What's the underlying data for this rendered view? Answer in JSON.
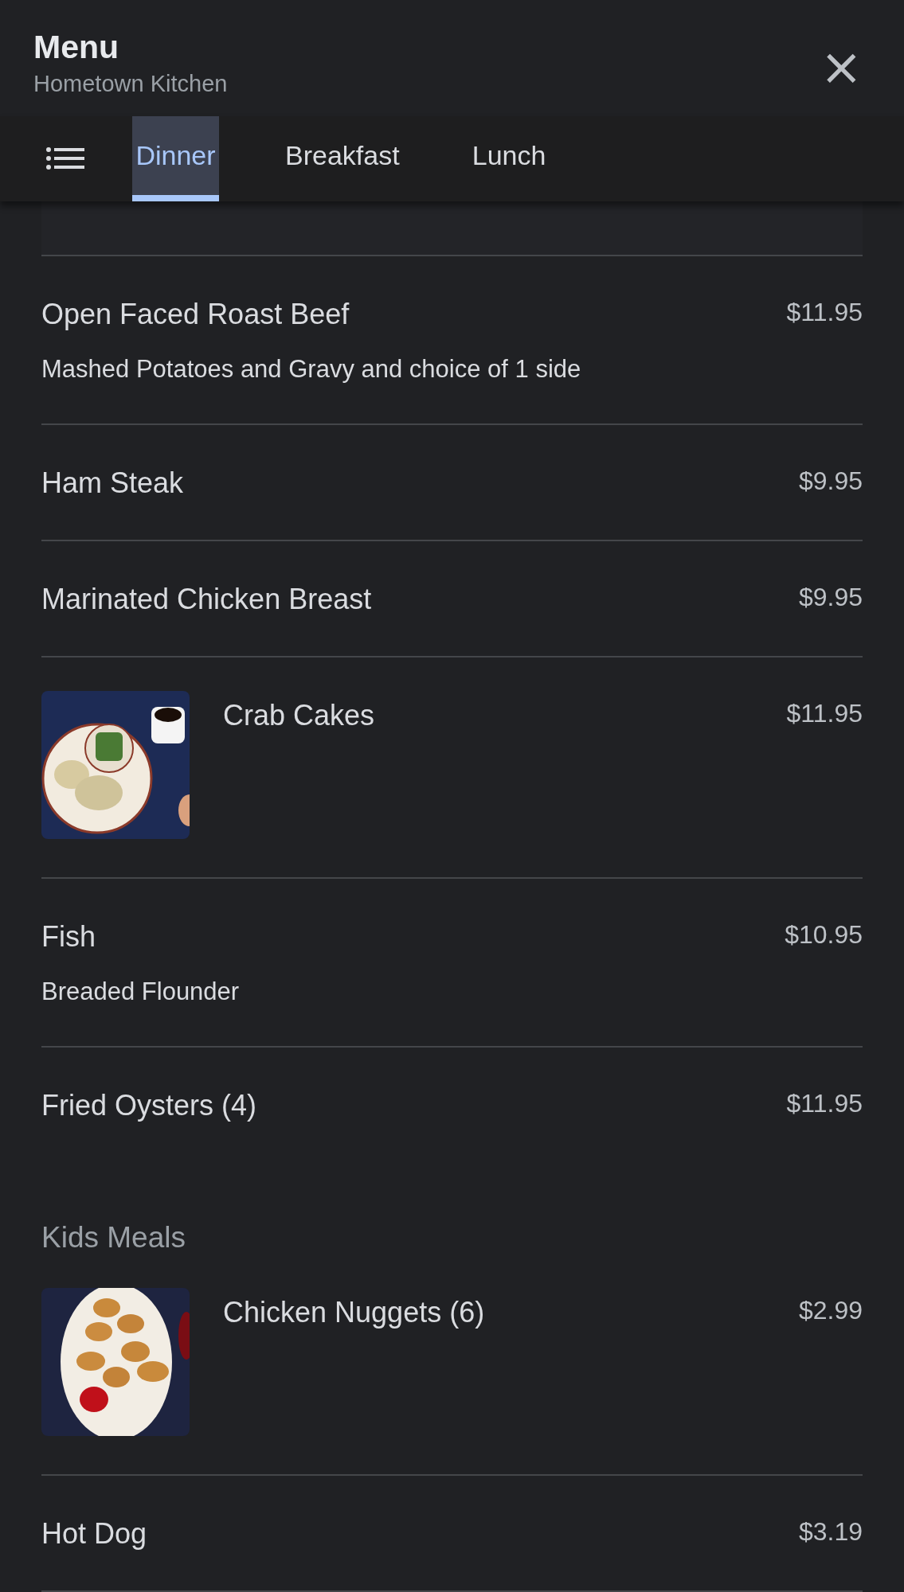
{
  "header": {
    "title": "Menu",
    "subtitle": "Hometown Kitchen",
    "close": "×"
  },
  "tabs": [
    {
      "label": "Dinner",
      "selected": true
    },
    {
      "label": "Breakfast",
      "selected": false
    },
    {
      "label": "Lunch",
      "selected": false
    }
  ],
  "sections": [
    {
      "items": [
        {
          "name": "Open Faced Roast Beef",
          "price": "$11.95",
          "description": "Mashed Potatoes and Gravy and choice of 1 side"
        },
        {
          "name": "Ham Steak",
          "price": "$9.95"
        },
        {
          "name": "Marinated Chicken Breast",
          "price": "$9.95"
        },
        {
          "name": "Crab Cakes",
          "price": "$11.95"
        },
        {
          "name": "Fish",
          "price": "$10.95",
          "description": "Breaded Flounder"
        },
        {
          "name": "Fried Oysters (4)",
          "price": "$11.95"
        }
      ]
    },
    {
      "heading": "Kids Meals",
      "items": [
        {
          "name": "Chicken Nuggets (6)",
          "price": "$2.99"
        },
        {
          "name": "Hot Dog",
          "price": "$3.19"
        }
      ]
    }
  ]
}
